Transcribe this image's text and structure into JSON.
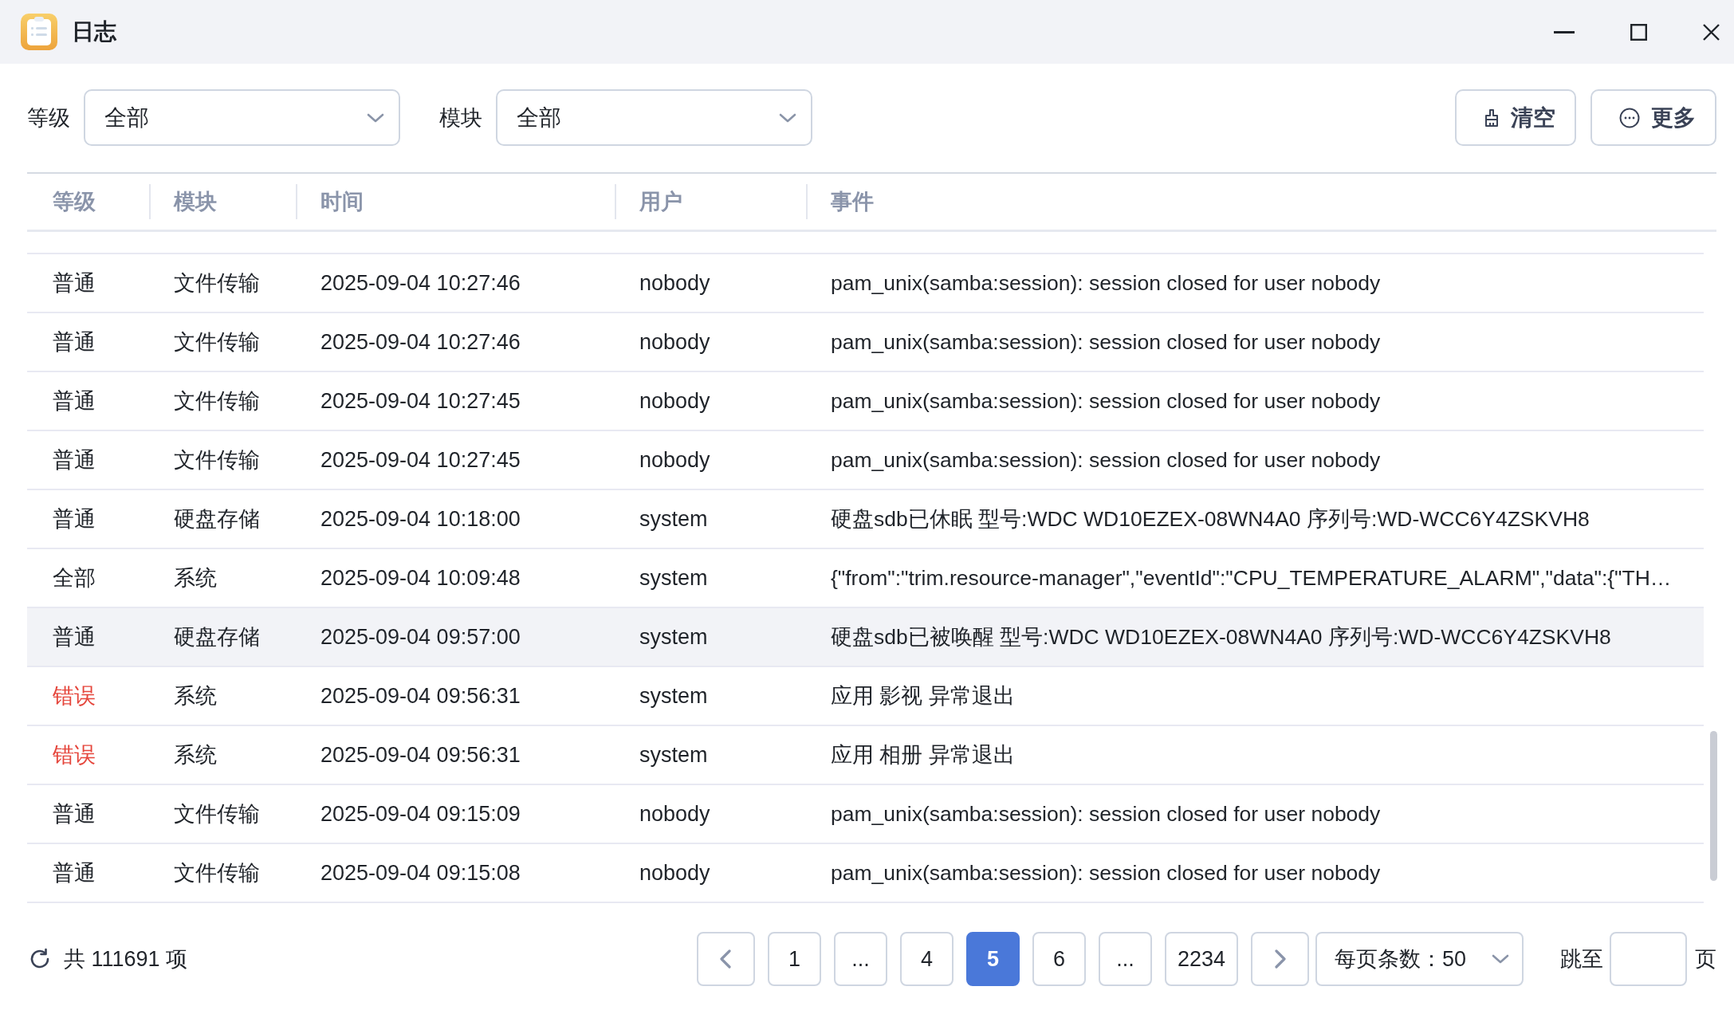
{
  "window": {
    "title": "日志"
  },
  "filters": [
    {
      "label": "等级",
      "value": "全部"
    },
    {
      "label": "模块",
      "value": "全部"
    }
  ],
  "actions": [
    {
      "kind": "clear",
      "label": "清空"
    },
    {
      "kind": "more",
      "label": "更多"
    }
  ],
  "table": {
    "columns": [
      "等级",
      "模块",
      "时间",
      "用户",
      "事件"
    ],
    "rows": [
      {
        "kind": "normal",
        "selected": false,
        "cells": [
          "普通",
          "文件传输",
          "2025-09-04 10:27:46",
          "nobody",
          "pam_unix(samba:session): session closed for user nobody"
        ]
      },
      {
        "kind": "normal",
        "selected": false,
        "cells": [
          "普通",
          "文件传输",
          "2025-09-04 10:27:46",
          "nobody",
          "pam_unix(samba:session): session closed for user nobody"
        ]
      },
      {
        "kind": "normal",
        "selected": false,
        "cells": [
          "普通",
          "文件传输",
          "2025-09-04 10:27:45",
          "nobody",
          "pam_unix(samba:session): session closed for user nobody"
        ]
      },
      {
        "kind": "normal",
        "selected": false,
        "cells": [
          "普通",
          "文件传输",
          "2025-09-04 10:27:45",
          "nobody",
          "pam_unix(samba:session): session closed for user nobody"
        ]
      },
      {
        "kind": "normal",
        "selected": false,
        "cells": [
          "普通",
          "硬盘存储",
          "2025-09-04 10:18:00",
          "system",
          "硬盘sdb已休眠 型号:WDC WD10EZEX-08WN4A0 序列号:WD-WCC6Y4ZSKVH8"
        ]
      },
      {
        "kind": "normal",
        "selected": false,
        "cells": [
          "全部",
          "系统",
          "2025-09-04 10:09:48",
          "system",
          "{\"from\":\"trim.resource-manager\",\"eventId\":\"CPU_TEMPERATURE_ALARM\",\"data\":{\"TH…"
        ]
      },
      {
        "kind": "normal",
        "selected": true,
        "cells": [
          "普通",
          "硬盘存储",
          "2025-09-04 09:57:00",
          "system",
          "硬盘sdb已被唤醒 型号:WDC WD10EZEX-08WN4A0 序列号:WD-WCC6Y4ZSKVH8"
        ]
      },
      {
        "kind": "error",
        "selected": false,
        "cells": [
          "错误",
          "系统",
          "2025-09-04 09:56:31",
          "system",
          "应用 影视 异常退出"
        ]
      },
      {
        "kind": "error",
        "selected": false,
        "cells": [
          "错误",
          "系统",
          "2025-09-04 09:56:31",
          "system",
          "应用 相册 异常退出"
        ]
      },
      {
        "kind": "normal",
        "selected": false,
        "cells": [
          "普通",
          "文件传输",
          "2025-09-04 09:15:09",
          "nobody",
          "pam_unix(samba:session): session closed for user nobody"
        ]
      },
      {
        "kind": "normal",
        "selected": false,
        "cells": [
          "普通",
          "文件传输",
          "2025-09-04 09:15:08",
          "nobody",
          "pam_unix(samba:session): session closed for user nobody"
        ]
      }
    ]
  },
  "footer": {
    "total": "共 111691 项",
    "pages": [
      {
        "label": "1",
        "selected": false
      },
      {
        "label": "...",
        "selected": false
      },
      {
        "label": "4",
        "selected": false
      },
      {
        "label": "5",
        "selected": true
      },
      {
        "label": "6",
        "selected": false
      },
      {
        "label": "...",
        "selected": false
      },
      {
        "label": "2234",
        "selected": false
      }
    ],
    "page_size": "每页条数：50",
    "jump_label": "跳至",
    "jump_suffix": "页"
  }
}
